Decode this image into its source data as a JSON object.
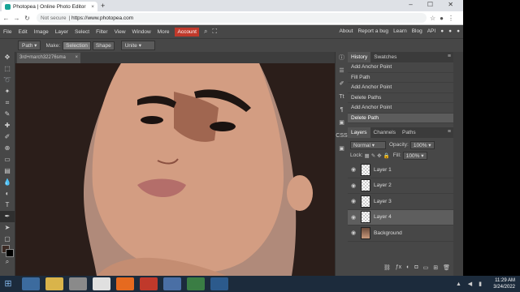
{
  "browser": {
    "tab_title": "Photopea | Online Photo Editor",
    "tab_close": "×",
    "new_tab": "+",
    "security_label": "Not secure",
    "url": "https://www.photopea.com",
    "window_controls": "– ☐ ✕"
  },
  "menubar": {
    "items": [
      "File",
      "Edit",
      "Image",
      "Layer",
      "Select",
      "Filter",
      "View",
      "Window",
      "More"
    ],
    "account": "Account",
    "right_links": [
      "About",
      "Report a bug",
      "Learn",
      "Blog",
      "API"
    ]
  },
  "options": {
    "mode": "Path",
    "make_label": "Make:",
    "make_selection": "Selection",
    "make_shape": "Shape",
    "combine": "Unite"
  },
  "document": {
    "tab_name": "3rd+march32276sma",
    "tab_close": "×"
  },
  "history": {
    "tabs": [
      "History",
      "Swatches"
    ],
    "items": [
      "Add Anchor Point",
      "Fill Path",
      "Add Anchor Point",
      "Delete Paths",
      "Add Anchor Point",
      "Delete Path"
    ],
    "active_index": 5
  },
  "layers": {
    "tabs": [
      "Layers",
      "Channels",
      "Paths"
    ],
    "blend_mode": "Normal",
    "opacity_label": "Opacity:",
    "opacity": "100%",
    "lock_label": "Lock:",
    "fill_label": "Fill:",
    "fill": "100%",
    "items": [
      "Layer 1",
      "Layer 2",
      "Layer 3",
      "Layer 4",
      "Background"
    ],
    "active_index": 3
  },
  "taskbar": {
    "time": "11:29 AM",
    "date": "3/24/2022"
  },
  "colors": {
    "accent": "#c0392b",
    "foreground_swatch": "#3b2a24",
    "background_swatch": "#000000"
  }
}
